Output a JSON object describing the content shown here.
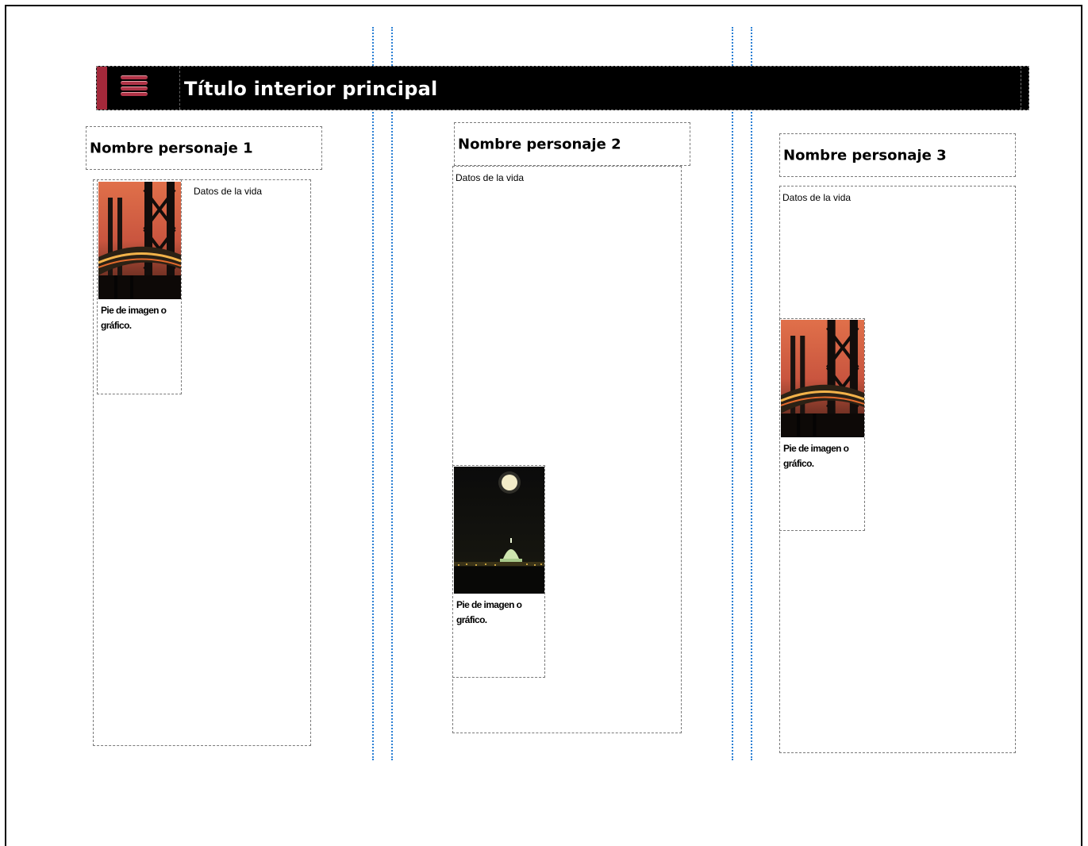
{
  "banner": {
    "title": "Título interior principal",
    "icon": "menu-lines-icon",
    "accent_color": "#a3283a"
  },
  "columns": [
    {
      "name": "Nombre personaje 1",
      "life_text": "Datos de la vida",
      "image": "bridge-sunset-photo",
      "caption": "Pie de imagen o gráfico."
    },
    {
      "name": "Nombre personaje 2",
      "life_text": "Datos de la vida",
      "image": "capitol-moon-night-photo",
      "caption": "Pie de imagen o gráfico."
    },
    {
      "name": "Nombre personaje 3",
      "life_text": "Datos de la vida",
      "image": "bridge-sunset-photo",
      "caption": "Pie de imagen o gráfico."
    }
  ],
  "colors": {
    "guide": "#2a7fd4",
    "banner_background": "#000000"
  }
}
